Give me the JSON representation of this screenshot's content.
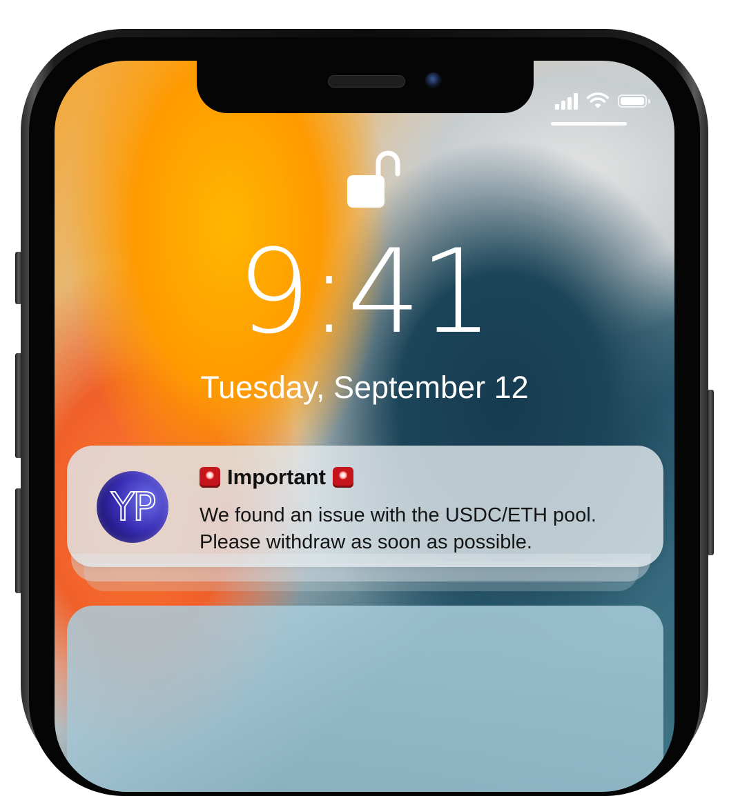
{
  "lockscreen": {
    "time": "9:41",
    "date": "Tuesday, September 12"
  },
  "notification": {
    "app_initials": "YP",
    "title": "Important",
    "body": "We found an issue with the USDC/ETH pool. Please withdraw as soon as possible.",
    "title_emoji": "police-car-light"
  },
  "status_bar": {
    "signal_bars": 4,
    "wifi": true,
    "battery_level": 1.0
  },
  "colors": {
    "notification_bg": "#e1e8ec",
    "avatar": "#3b2fb6",
    "siren": "#c4141c",
    "text": "#ffffff"
  }
}
